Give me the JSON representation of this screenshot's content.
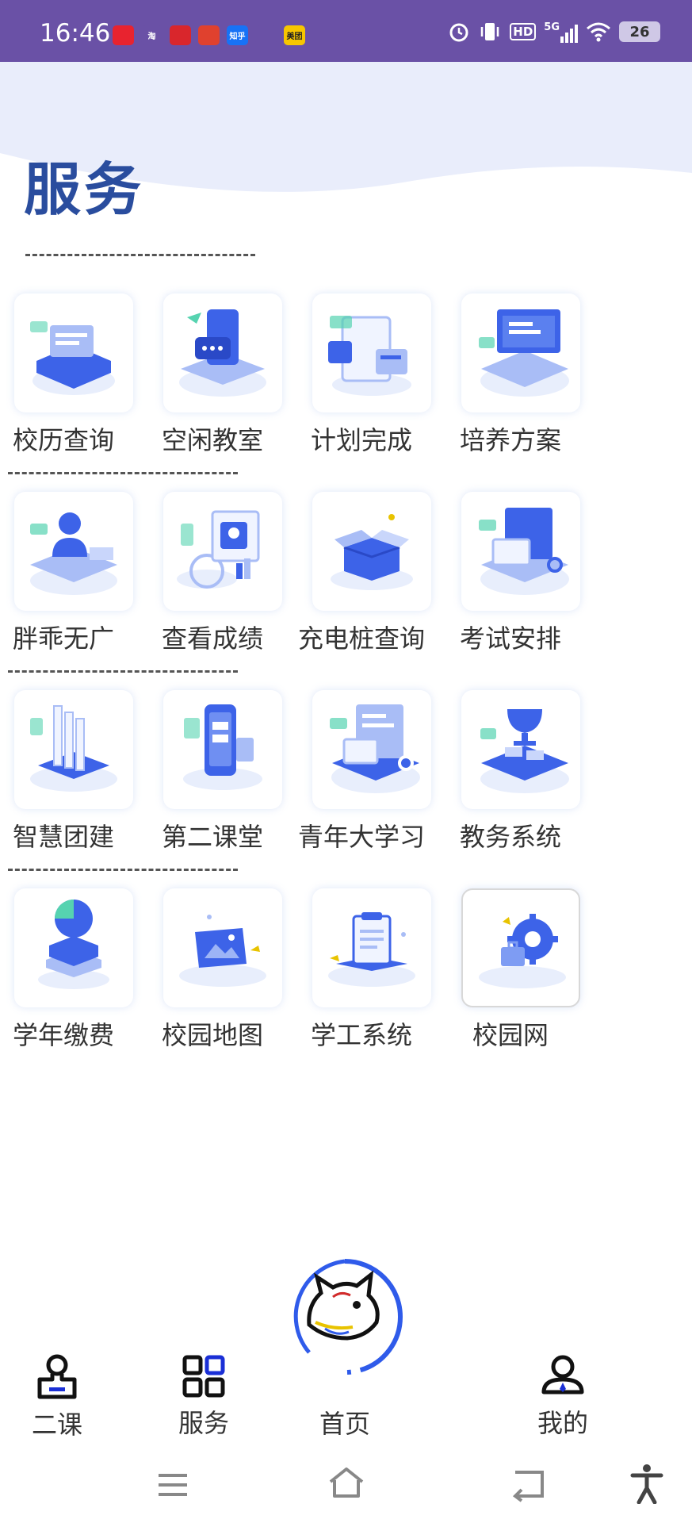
{
  "status_bar": {
    "time": "16:46",
    "notifications": [
      {
        "icon": "tmall-icon",
        "text": "",
        "color": "#e8232f"
      },
      {
        "icon": "taobao-icon",
        "text": "淘",
        "color": "#6a51a6"
      },
      {
        "icon": "app-red-icon",
        "text": "",
        "color": "#d9262c"
      },
      {
        "icon": "app-red2-icon",
        "text": "",
        "color": "#e0412e"
      },
      {
        "icon": "zhihu-icon",
        "text": "知乎",
        "color": "#1772f6"
      },
      {
        "icon": "app-swirl-icon",
        "text": "",
        "color": "#6a51a6"
      },
      {
        "icon": "meituan-icon",
        "text": "美团",
        "color": "#f7c600"
      }
    ],
    "network": "5G",
    "hd": "HD",
    "battery": "26"
  },
  "header": {
    "title": "服务"
  },
  "services": [
    {
      "label": "校历查询",
      "icon": "calendar-server-icon"
    },
    {
      "label": "空闲教室",
      "icon": "chat-phone-icon"
    },
    {
      "label": "计划完成",
      "icon": "plan-cards-icon"
    },
    {
      "label": "培养方案",
      "icon": "monitor-plan-icon"
    },
    {
      "label": "胖乖无广",
      "icon": "user-desk-icon"
    },
    {
      "label": "查看成绩",
      "icon": "grade-screen-icon"
    },
    {
      "label": "充电桩查询",
      "icon": "box-icon"
    },
    {
      "label": "考试安排",
      "icon": "exam-printer-icon"
    },
    {
      "label": "智慧团建",
      "icon": "docs-stack-icon"
    },
    {
      "label": "第二课堂",
      "icon": "phone-class-icon"
    },
    {
      "label": "青年大学习",
      "icon": "study-printer-icon"
    },
    {
      "label": "教务系统",
      "icon": "trophy-icon"
    },
    {
      "label": "学年缴费",
      "icon": "pie-chart-icon"
    },
    {
      "label": "校园地图",
      "icon": "map-picture-icon"
    },
    {
      "label": "学工系统",
      "icon": "clipboard-icon"
    },
    {
      "label": "校园网",
      "icon": "gear-bag-icon"
    }
  ],
  "bottom_nav": {
    "items": [
      {
        "label": "二课",
        "icon": "stamp-icon"
      },
      {
        "label": "服务",
        "icon": "grid-icon"
      },
      {
        "label": "首页",
        "icon": "wolf-logo-icon"
      },
      {
        "label": "我的",
        "icon": "user-icon"
      }
    ]
  },
  "colors": {
    "status_bar": "#6a51a6",
    "title": "#2a4d9e",
    "accent": "#2f5bea",
    "nav_active": "#1a2fd6"
  }
}
